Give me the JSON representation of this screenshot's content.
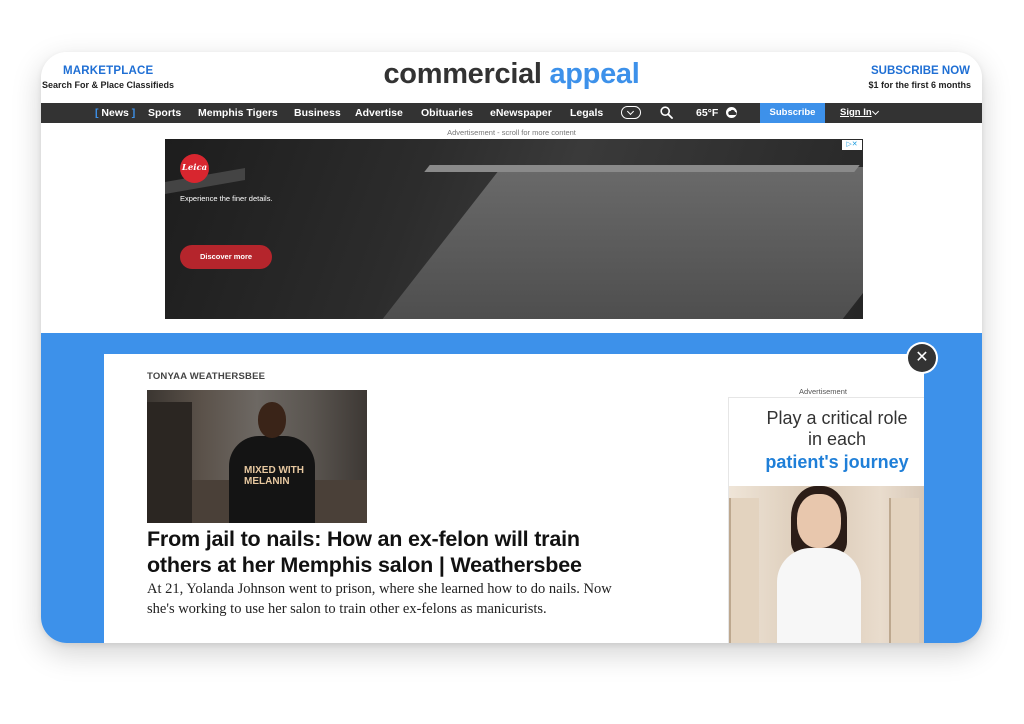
{
  "header": {
    "marketplace": "MARKETPLACE",
    "marketplace_sub": "Search For & Place Classifieds",
    "logo_part1": "commercial",
    "logo_part2": "appeal",
    "subscribe": "SUBSCRIBE NOW",
    "subscribe_sub": "$1 for the first 6 months"
  },
  "nav": {
    "items": [
      "News",
      "Sports",
      "Memphis Tigers",
      "Business",
      "Advertise",
      "Obituaries",
      "eNewspaper",
      "Legals"
    ],
    "temperature": "65°F",
    "subscribe_button": "Subscribe",
    "sign_in": "Sign In"
  },
  "ad_top": {
    "label": "Advertisement - scroll for more content",
    "brand": "Leica",
    "tagline": "Experience the finer details.",
    "cta": "Discover more"
  },
  "article": {
    "author": "TONYAA WEATHERSBEE",
    "photo_shirt_text": "MIXED WITH MELANIN",
    "headline": "From jail to nails: How an ex-felon will train others at her Memphis salon | Weathersbee",
    "dek": "At 21, Yolanda Johnson went to prison, where she learned how to do nails. Now she's working to use her salon to train other ex-felons as manicurists."
  },
  "ad_side": {
    "label": "Advertisement",
    "line1": "Play a critical role in each",
    "line2": "patient's journey"
  },
  "colors": {
    "brand_blue": "#3d91ea",
    "nav_bg": "#333333",
    "ad_red": "#b5252c"
  }
}
